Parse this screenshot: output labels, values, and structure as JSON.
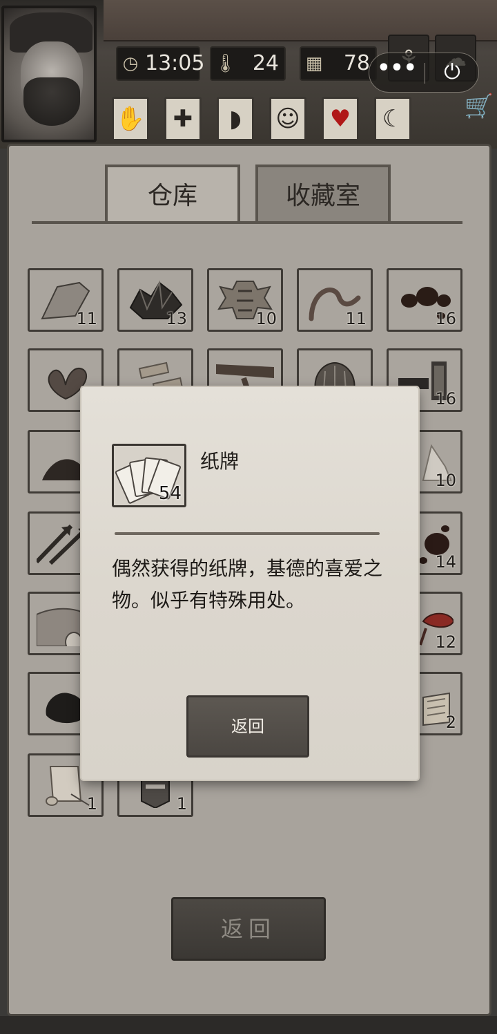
{
  "stats": {
    "time": "13:05",
    "temperature": "24",
    "day": "78",
    "clock_icon": "clock-icon",
    "thermometer_icon": "thermometer-icon",
    "calendar_icon": "calendar-icon"
  },
  "capsule": {
    "more_label": "•••",
    "power_label": "⏻"
  },
  "tabs": {
    "warehouse": "仓库",
    "collection": "收藏室"
  },
  "slots": [
    {
      "id": "stone",
      "count": "11"
    },
    {
      "id": "ore",
      "count": "13"
    },
    {
      "id": "hide",
      "count": "10"
    },
    {
      "id": "worm",
      "count": "11"
    },
    {
      "id": "tar",
      "count": "16"
    },
    {
      "id": "herb",
      "count": ""
    },
    {
      "id": "wood",
      "count": ""
    },
    {
      "id": "branch",
      "count": ""
    },
    {
      "id": "shell",
      "count": ""
    },
    {
      "id": "gun",
      "count": "16"
    },
    {
      "id": "soil",
      "count": ""
    },
    {
      "id": "salt",
      "count": "10"
    },
    {
      "id": "arrows",
      "count": ""
    },
    {
      "id": "blood",
      "count": "14"
    },
    {
      "id": "fish",
      "count": ""
    },
    {
      "id": "mushroom",
      "count": "12"
    },
    {
      "id": "coal",
      "count": ""
    },
    {
      "id": "book",
      "count": "2"
    },
    {
      "id": "scroll",
      "count": "1"
    },
    {
      "id": "helmet",
      "count": "1"
    }
  ],
  "main_back_label": "返回",
  "modal": {
    "item_name": "纸牌",
    "item_count": "54",
    "description": "偶然获得的纸牌，基德的喜爱之物。似乎有特殊用处。",
    "back_label": "返回"
  },
  "colors": {
    "panel": "#a8a39c",
    "modal": "#e0dcd4",
    "heart": "#b01818",
    "button_dark": "#4b4742"
  }
}
